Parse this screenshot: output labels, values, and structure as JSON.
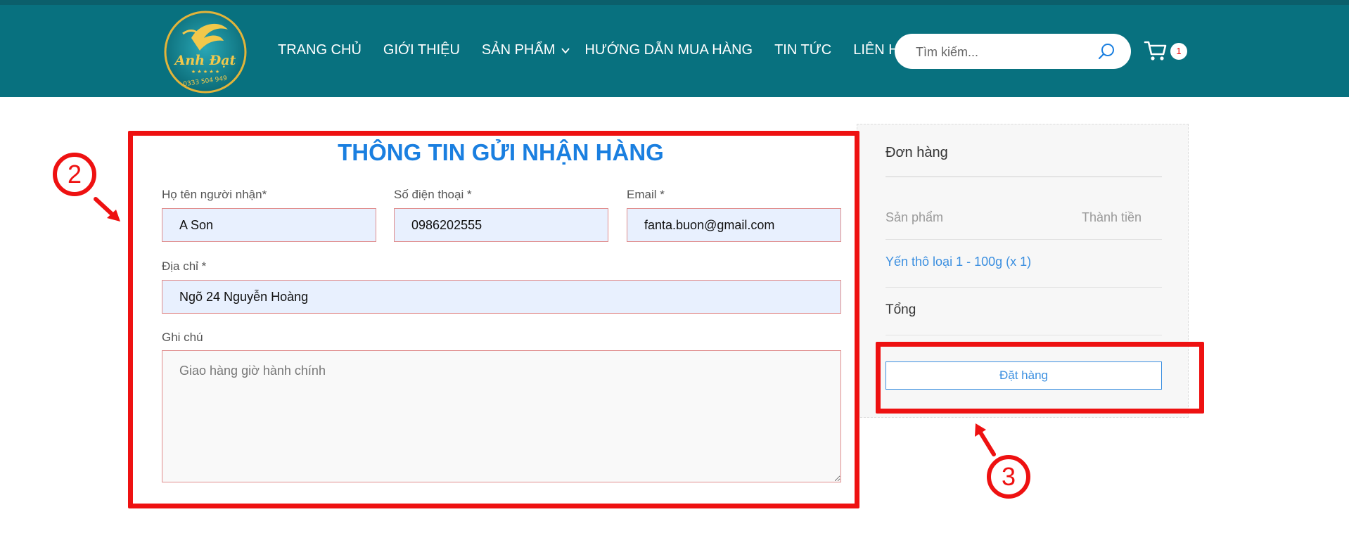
{
  "header": {
    "logo_text": "Anh Đạt",
    "logo_phone": "0333 504 949",
    "nav": [
      {
        "label": "TRANG CHỦ"
      },
      {
        "label": "GIỚI THIỆU"
      },
      {
        "label": "SẢN PHẨM"
      },
      {
        "label": "HƯỚNG DẪN MUA HÀNG"
      },
      {
        "label": "TIN TỨC"
      },
      {
        "label": "LIÊN HỆ"
      }
    ],
    "search_placeholder": "Tìm kiếm...",
    "cart_count": "1"
  },
  "form": {
    "title": "THÔNG TIN GỬI NHẬN HÀNG",
    "name_label": "Họ tên người nhận*",
    "name_value": "A Son",
    "phone_label": "Số điện thoại *",
    "phone_value": "0986202555",
    "email_label": "Email *",
    "email_value": "fanta.buon@gmail.com",
    "address_label": "Địa chỉ *",
    "address_value": "Ngõ 24 Nguyễn Hoàng",
    "note_label": "Ghi chú",
    "note_placeholder": "Giao hàng giờ hành chính"
  },
  "order": {
    "title": "Đơn hàng",
    "col_product": "Sản phẩm",
    "col_total": "Thành tiền",
    "item": "Yến thô loại 1 - 100g (x 1)",
    "total_label": "Tổng",
    "place_button": "Đặt hàng"
  },
  "annotations": {
    "step_form": "2",
    "step_order": "3",
    "color": "#ee1111"
  },
  "colors": {
    "header_bg": "#08717f",
    "accent_blue": "#1a7fe0",
    "link_blue": "#3b8fe0"
  }
}
